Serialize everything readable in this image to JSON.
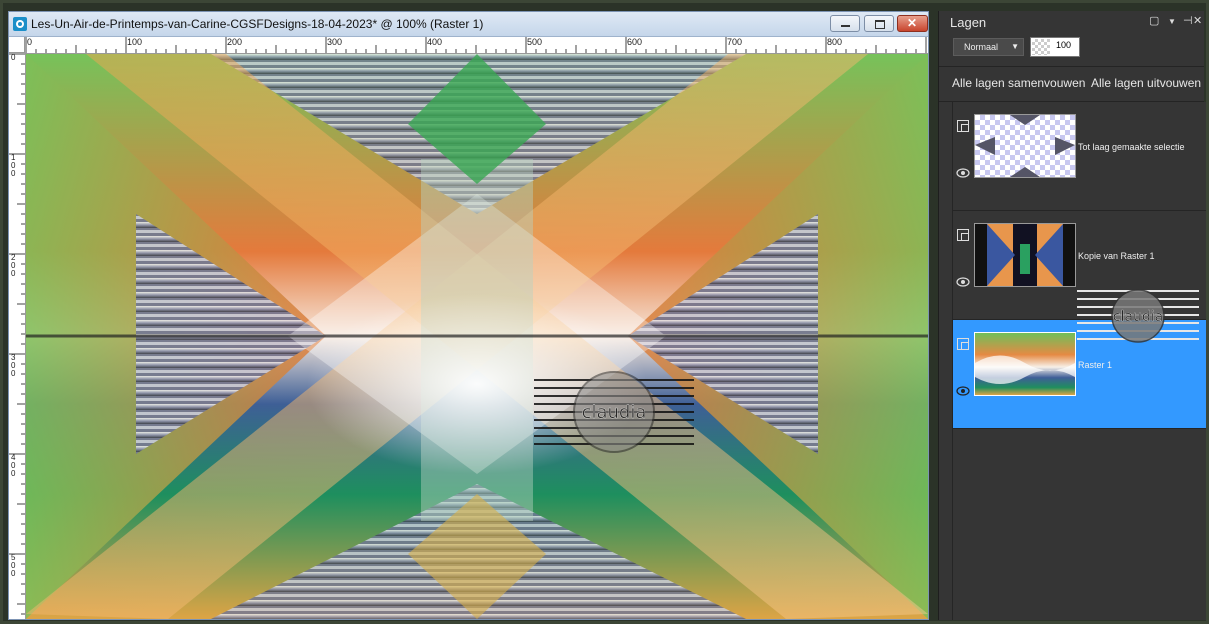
{
  "document": {
    "title": "Les-Un-Air-de-Printemps-van-Carine-CGSFDesigns-18-04-2023* @ 100% (Raster 1)",
    "ruler_h": [
      "0",
      "100",
      "200",
      "300",
      "400",
      "500",
      "600",
      "700",
      "800"
    ],
    "ruler_v": [
      "0",
      "100",
      "200",
      "300",
      "400",
      "500"
    ]
  },
  "watermark": {
    "text": "claudia"
  },
  "layers_palette": {
    "title": "Lagen",
    "blend_mode": "Normaal",
    "opacity": "100",
    "collapse_all": "Alle lagen samenvouwen",
    "expand_all": "Alle lagen uitvouwen",
    "layers": [
      {
        "name": "Tot laag gemaakte selectie",
        "selected": false
      },
      {
        "name": "Kopie van Raster 1",
        "selected": false
      },
      {
        "name": "Raster 1",
        "selected": true
      }
    ]
  },
  "colors": {
    "selection": "#3399ff",
    "panel_bg": "#353535",
    "titlebar": "#c5d6ea",
    "close_button": "#c8452d"
  }
}
